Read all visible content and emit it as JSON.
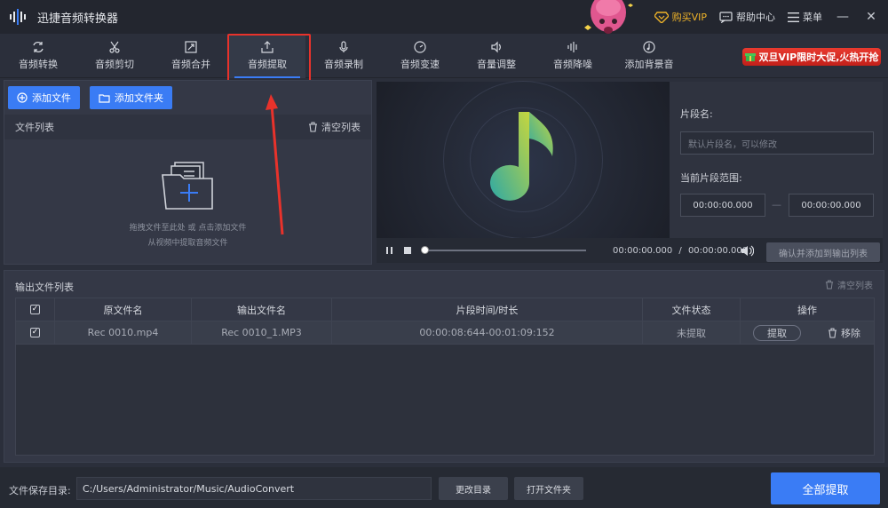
{
  "app": {
    "title": "迅捷音频转换器"
  },
  "titlebar": {
    "vip": "购买VIP",
    "help": "帮助中心",
    "menu": "菜单",
    "minimize": "—",
    "close": "✕"
  },
  "tabs": [
    {
      "label": "音频转换",
      "icon": "convert-icon"
    },
    {
      "label": "音频剪切",
      "icon": "scissors-icon"
    },
    {
      "label": "音频合并",
      "icon": "merge-icon"
    },
    {
      "label": "音频提取",
      "icon": "extract-icon",
      "active": true
    },
    {
      "label": "音频录制",
      "icon": "microphone-icon"
    },
    {
      "label": "音频变速",
      "icon": "speed-icon"
    },
    {
      "label": "音量调整",
      "icon": "volume-icon"
    },
    {
      "label": "音频降噪",
      "icon": "noise-icon"
    },
    {
      "label": "添加背景音",
      "icon": "music-note-icon"
    }
  ],
  "promo": "双旦VIP限时大促,火热开抢",
  "left": {
    "add_file": "添加文件",
    "add_folder": "添加文件夹",
    "file_list": "文件列表",
    "clear_list": "清空列表",
    "drop_hint1": "拖拽文件至此处 或 点击添加文件",
    "drop_hint2": "从视频中提取音频文件"
  },
  "segment": {
    "name_label": "片段名:",
    "name_placeholder": "默认片段名，可以修改",
    "range_label": "当前片段范围:",
    "start": "00:00:00.000",
    "end": "00:00:00.000",
    "dash": "—"
  },
  "player": {
    "current": "00:00:00.000",
    "sep": "/",
    "total": "00:00:00.000",
    "confirm": "确认并添加到输出列表",
    "progress": 0
  },
  "output": {
    "title": "输出文件列表",
    "clear": "清空列表",
    "columns": [
      "原文件名",
      "输出文件名",
      "片段时间/时长",
      "文件状态",
      "操作"
    ],
    "rows": [
      {
        "checked": "✓",
        "source": "Rec 0010.mp4",
        "output": "Rec 0010_1.MP3",
        "duration": "00:00:08:644-00:01:09:152",
        "status": "未提取",
        "extract": "提取",
        "remove": "移除"
      }
    ],
    "header_check": "✓"
  },
  "bottom": {
    "save_label": "文件保存目录:",
    "path": "C:/Users/Administrator/Music/AudioConvert",
    "change_dir": "更改目录",
    "open_folder": "打开文件夹",
    "extract_all": "全部提取"
  },
  "colors": {
    "accent": "#3a7cf5",
    "highlight": "#e8322b",
    "vip": "#f0b429"
  }
}
